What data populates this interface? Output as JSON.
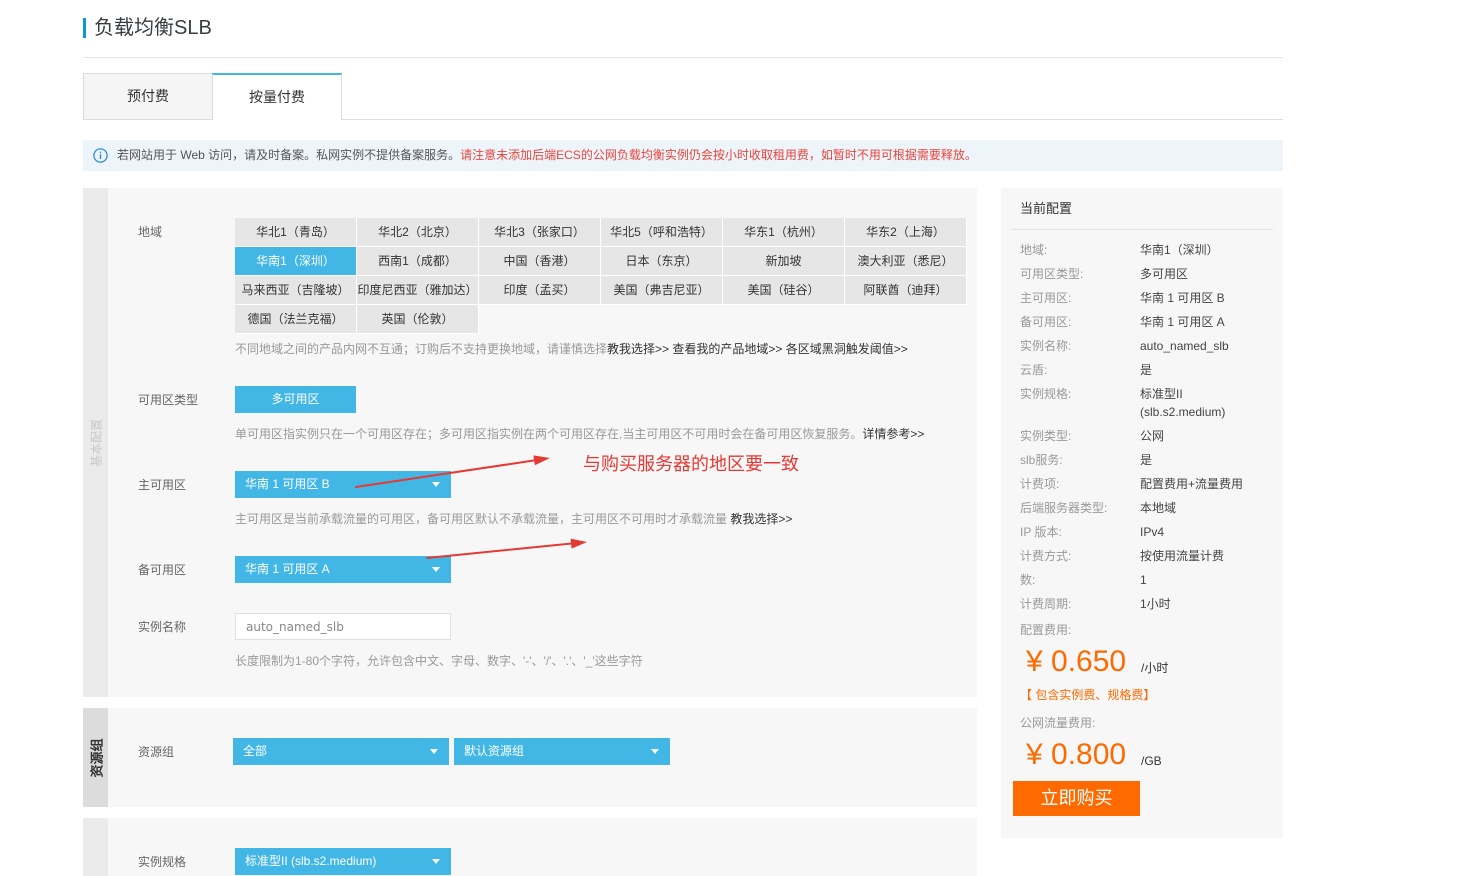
{
  "page": {
    "title": "负载均衡SLB"
  },
  "tabs": [
    {
      "label": "预付费",
      "active": false
    },
    {
      "label": "按量付费",
      "active": true
    }
  ],
  "notice": {
    "icon": "info-icon",
    "text": "若网站用于 Web 访问，请及时备案。私网实例不提供备案服务。",
    "warning": "请注意未添加后端ECS的公网负载均衡实例仍会按小时收取租用费，如暂时不用可根据需要释放。"
  },
  "basic": {
    "section_label": "基本配置",
    "region": {
      "label": "地域",
      "options": [
        {
          "label": "华北1（青岛）"
        },
        {
          "label": "华北2（北京）"
        },
        {
          "label": "华北3（张家口）"
        },
        {
          "label": "华北5（呼和浩特）"
        },
        {
          "label": "华东1（杭州）"
        },
        {
          "label": "华东2（上海）"
        },
        {
          "label": "华南1（深圳）",
          "selected": true
        },
        {
          "label": "西南1（成都）"
        },
        {
          "label": "中国（香港）"
        },
        {
          "label": "日本（东京）"
        },
        {
          "label": "新加坡"
        },
        {
          "label": "澳大利亚（悉尼）"
        },
        {
          "label": "马来西亚（吉隆坡）"
        },
        {
          "label": "印度尼西亚（雅加达）"
        },
        {
          "label": "印度（孟买）"
        },
        {
          "label": "美国（弗吉尼亚）"
        },
        {
          "label": "美国（硅谷）"
        },
        {
          "label": "阿联酋（迪拜）"
        },
        {
          "label": "德国（法兰克福）"
        },
        {
          "label": "英国（伦敦）"
        }
      ],
      "help": "不同地域之间的产品内网不互通；订购后不支持更换地域，请谨慎选择",
      "links": [
        "教我选择>>",
        "查看我的产品地域>>",
        "各区域黑洞触发阈值>>"
      ]
    },
    "zone_type": {
      "label": "可用区类型",
      "value": "多可用区",
      "help": "单可用区指实例只在一个可用区存在；多可用区指实例在两个可用区存在,当主可用区不可用时会在备可用区恢复服务。",
      "link": "详情参考>>"
    },
    "primary_zone": {
      "label": "主可用区",
      "value": "华南 1 可用区 B",
      "help": "主可用区是当前承载流量的可用区，备可用区默认不承载流量，主可用区不可用时才承载流量 ",
      "link": "教我选择>>"
    },
    "backup_zone": {
      "label": "备可用区",
      "value": "华南 1 可用区 A"
    },
    "instance_name": {
      "label": "实例名称",
      "value": "auto_named_slb",
      "help": "长度限制为1-80个字符，允许包含中文、字母、数字、'-'、'/'、'.'、'_'这些字符"
    }
  },
  "annotation": {
    "text": "与购买服务器的地区要一致"
  },
  "resource_group": {
    "section_label": "资源组",
    "label": "资源组",
    "scope": "全部",
    "group": "默认资源组"
  },
  "instance_spec": {
    "label": "实例规格",
    "value": "标准型II (slb.s2.medium)"
  },
  "summary": {
    "title": "当前配置",
    "rows": [
      {
        "label": "地域:",
        "value": "华南1（深圳）"
      },
      {
        "label": "可用区类型:",
        "value": "多可用区"
      },
      {
        "label": "主可用区:",
        "value": "华南 1 可用区 B"
      },
      {
        "label": "备可用区:",
        "value": "华南 1 可用区 A"
      },
      {
        "label": "实例名称:",
        "value": "auto_named_slb"
      },
      {
        "label": "云盾:",
        "value": "是"
      },
      {
        "label": "实例规格:",
        "value": "标准型II (slb.s2.medium)"
      },
      {
        "label": "实例类型:",
        "value": "公网"
      },
      {
        "label": "slb服务:",
        "value": "是"
      },
      {
        "label": "计费项:",
        "value": "配置费用+流量费用"
      },
      {
        "label": "后端服务器类型:",
        "value": "本地域"
      },
      {
        "label": "IP 版本:",
        "value": "IPv4"
      },
      {
        "label": "计费方式:",
        "value": "按使用流量计费"
      },
      {
        "label": "数:",
        "value": "1"
      },
      {
        "label": "计费周期:",
        "value": "1小时"
      }
    ],
    "config_fee_label": "配置费用:",
    "config_price": "¥ 0.650",
    "config_unit": "/小时",
    "config_note": "【 包含实例费、规格费】",
    "traffic_fee_label": "公网流量费用:",
    "traffic_price": "¥ 0.800",
    "traffic_unit": "/GB",
    "buy_label": "立即购买"
  },
  "icons": {
    "notice": "info-icon",
    "dropdown": "caret-down-icon",
    "annotation": "red-arrow-icon"
  },
  "colors": {
    "accent": "#42b7e6",
    "title_bar": "#0e96d6",
    "price": "#ff6a00",
    "buy_button": "#ff6a00",
    "warning_text": "#e8453c",
    "annotation": "#e53935"
  }
}
